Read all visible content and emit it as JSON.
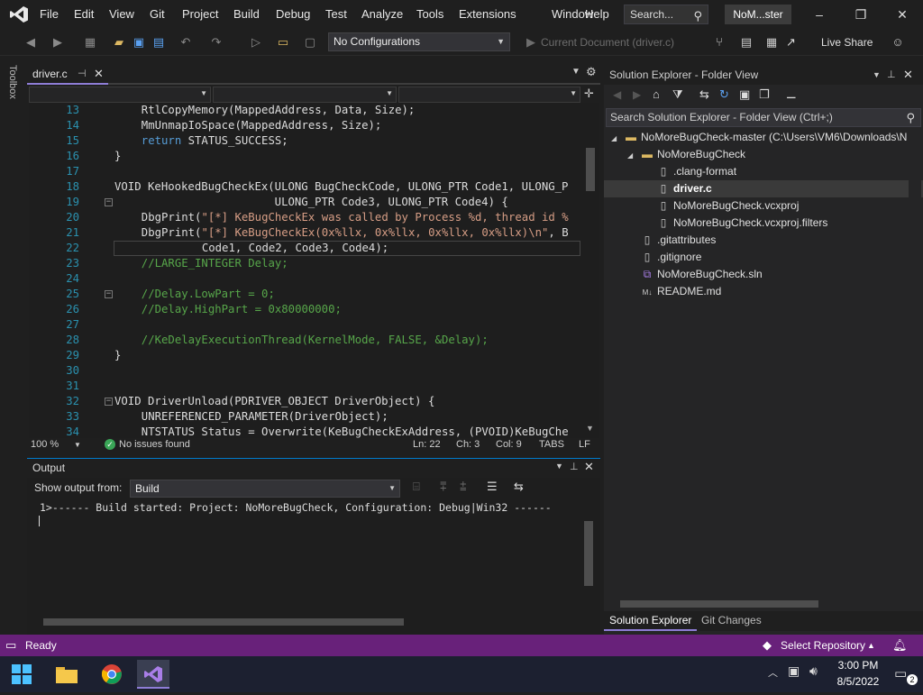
{
  "app": {
    "menu": [
      "File",
      "Edit",
      "View",
      "Git",
      "Project",
      "Build",
      "Debug",
      "Test",
      "Analyze",
      "Tools",
      "Extensions",
      "Window",
      "Help"
    ],
    "search_placeholder": "Search...",
    "solution_badge": "NoM...ster",
    "window_buttons": {
      "minimize": "–",
      "maximize": "❐",
      "close": "✕"
    }
  },
  "toolbar": {
    "config": "No Configurations",
    "start_document": "Current Document (driver.c)",
    "live_share": "Live Share"
  },
  "toolbox_label": "Toolbox",
  "editor": {
    "tab": "driver.c",
    "lines": [
      {
        "n": "13",
        "html_text": "RtlCopyMemory(MappedAddress, Data, Size);",
        "indent": 4,
        "kind": "plain"
      },
      {
        "n": "14",
        "html_text": "MmUnmapIoSpace(MappedAddress, Size);",
        "indent": 4,
        "kind": "plain"
      },
      {
        "n": "15",
        "kw": "return",
        "rest": " STATUS_SUCCESS;",
        "indent": 4,
        "kind": "kw"
      },
      {
        "n": "16",
        "html_text": "}",
        "indent": 0,
        "kind": "plain"
      },
      {
        "n": "17",
        "html_text": "",
        "indent": 0,
        "kind": "plain"
      },
      {
        "n": "18",
        "html_text": "VOID KeHookedBugCheckEx(ULONG BugCheckCode, ULONG_PTR Code1, ULONG_P",
        "indent": 0,
        "kind": "plain"
      },
      {
        "n": "19",
        "html_text": "                        ULONG_PTR Code3, ULONG_PTR Code4) {",
        "indent": 0,
        "kind": "plain"
      },
      {
        "n": "20",
        "pre": "DbgPrint(",
        "str": "\"[*] KeBugCheckEx was called by Process %d, thread id %",
        "indent": 4,
        "kind": "str"
      },
      {
        "n": "21",
        "pre": "DbgPrint(",
        "str": "\"[*] KeBugCheckEx(0x%llx, 0x%llx, 0x%llx, 0x%llx)\\n\"",
        "post": ", B",
        "indent": 4,
        "kind": "str"
      },
      {
        "n": "22",
        "html_text": "Code1, Code2, Code3, Code4);",
        "indent": 13,
        "kind": "plain"
      },
      {
        "n": "23",
        "html_text": "//LARGE_INTEGER Delay;",
        "indent": 4,
        "kind": "cm"
      },
      {
        "n": "24",
        "html_text": "",
        "indent": 0,
        "kind": "plain"
      },
      {
        "n": "25",
        "html_text": "//Delay.LowPart = 0;",
        "indent": 4,
        "kind": "cm"
      },
      {
        "n": "26",
        "html_text": "//Delay.HighPart = 0x80000000;",
        "indent": 4,
        "kind": "cm"
      },
      {
        "n": "27",
        "html_text": "",
        "indent": 0,
        "kind": "plain"
      },
      {
        "n": "28",
        "html_text": "//KeDelayExecutionThread(KernelMode, FALSE, &Delay);",
        "indent": 4,
        "kind": "cm"
      },
      {
        "n": "29",
        "html_text": "}",
        "indent": 0,
        "kind": "plain"
      },
      {
        "n": "30",
        "html_text": "",
        "indent": 0,
        "kind": "plain"
      },
      {
        "n": "31",
        "html_text": "",
        "indent": 0,
        "kind": "plain"
      },
      {
        "n": "32",
        "html_text": "VOID DriverUnload(PDRIVER_OBJECT DriverObject) {",
        "indent": 0,
        "kind": "plain"
      },
      {
        "n": "33",
        "html_text": "UNREFERENCED_PARAMETER(DriverObject);",
        "indent": 4,
        "kind": "plain"
      },
      {
        "n": "34",
        "html_text": "NTSTATUS Status = Overwrite(KeBugCheckExAddress, (PVOID)KeBugChe",
        "indent": 4,
        "kind": "plain"
      }
    ],
    "status": {
      "zoom": "100 %",
      "issues": "No issues found",
      "ln": "Ln: 22",
      "ch": "Ch: 3",
      "col": "Col: 9",
      "tabs": "TABS",
      "eol": "LF"
    }
  },
  "output": {
    "title": "Output",
    "show_from_label": "Show output from:",
    "source": "Build",
    "text": "1>------ Build started: Project: NoMoreBugCheck, Configuration: Debug|Win32 ------"
  },
  "solution_explorer": {
    "title": "Solution Explorer - Folder View",
    "search_placeholder": "Search Solution Explorer - Folder View (Ctrl+;)",
    "items": [
      {
        "label": "NoMoreBugCheck-master (C:\\Users\\VM6\\Downloads\\N",
        "icon": "folder-icon",
        "level": 0,
        "expander": "◢"
      },
      {
        "label": "NoMoreBugCheck",
        "icon": "folder-icon",
        "level": 1,
        "expander": "◢"
      },
      {
        "label": ".clang-format",
        "icon": "file-icon",
        "level": 2,
        "expander": ""
      },
      {
        "label": "driver.c",
        "icon": "c-file-icon",
        "level": 2,
        "expander": "",
        "selected": true
      },
      {
        "label": "NoMoreBugCheck.vcxproj",
        "icon": "file-icon",
        "level": 2,
        "expander": ""
      },
      {
        "label": "NoMoreBugCheck.vcxproj.filters",
        "icon": "file-icon",
        "level": 2,
        "expander": ""
      },
      {
        "label": ".gitattributes",
        "icon": "file-icon",
        "level": 1,
        "expander": ""
      },
      {
        "label": ".gitignore",
        "icon": "file-icon",
        "level": 1,
        "expander": ""
      },
      {
        "label": "NoMoreBugCheck.sln",
        "icon": "sln-icon",
        "level": 1,
        "expander": ""
      },
      {
        "label": "README.md",
        "icon": "markdown-icon",
        "level": 1,
        "expander": ""
      }
    ],
    "tabs": [
      "Solution Explorer",
      "Git Changes"
    ]
  },
  "statusbar": {
    "ready": "Ready",
    "select_repo": "Select Repository"
  },
  "taskbar": {
    "time": "3:00 PM",
    "date": "8/5/2022",
    "notif_count": "2"
  },
  "colors": {
    "accent": "#68217a",
    "selection_underline": "#8e7dd6",
    "keyword": "#569cd6",
    "string": "#d69d85",
    "comment": "#57a64a",
    "line_number": "#2b91af"
  }
}
